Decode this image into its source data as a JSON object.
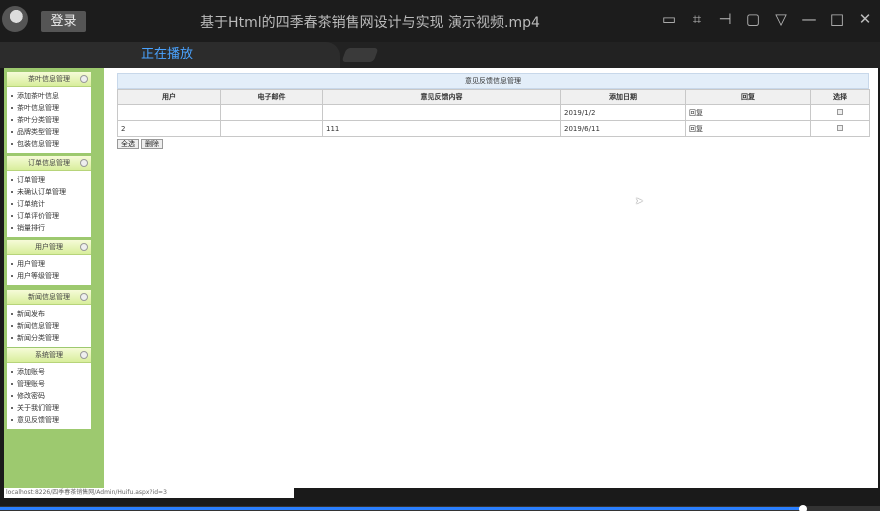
{
  "titlebar": {
    "login": "登录",
    "title": "基于Html的四季春茶销售网设计与实现 演示视频.mp4"
  },
  "tabbar": {
    "active_tab": "正在播放"
  },
  "sidebar": {
    "groups": [
      {
        "title": "茶叶信息管理",
        "items": [
          "添加茶叶信息",
          "茶叶信息管理",
          "茶叶分类管理",
          "品牌类型管理",
          "包装信息管理"
        ]
      },
      {
        "title": "订单信息管理",
        "items": [
          "订单管理",
          "未确认订单管理",
          "订单统计",
          "订单评价管理",
          "销量排行"
        ]
      },
      {
        "title": "用户管理",
        "items": [
          "用户管理",
          "用户等级管理"
        ]
      },
      {
        "title": "新闻信息管理",
        "items": [
          "新闻发布",
          "新闻信息管理",
          "新闻分类管理"
        ]
      },
      {
        "title": "系统管理",
        "items": [
          "添加账号",
          "管理账号",
          "修改密码",
          "关于我们管理",
          "意见反馈管理"
        ]
      }
    ]
  },
  "main": {
    "caption": "意见反馈信息管理",
    "columns": [
      "用户",
      "电子邮件",
      "意见反馈内容",
      "添加日期",
      "回复",
      "选择"
    ],
    "rows": [
      [
        "",
        "",
        "",
        "2019/1/2",
        "回复"
      ],
      [
        "2",
        "",
        "111",
        "2019/6/11",
        "回复"
      ]
    ],
    "buttons": {
      "select_all": "全选",
      "delete": "删除"
    }
  },
  "status": {
    "url": "localhost:8226/四季春茶销售网/Admin/Huifu.aspx?id=3"
  },
  "playback": {
    "progress": 0.912,
    "accent": "#2a7fff"
  }
}
